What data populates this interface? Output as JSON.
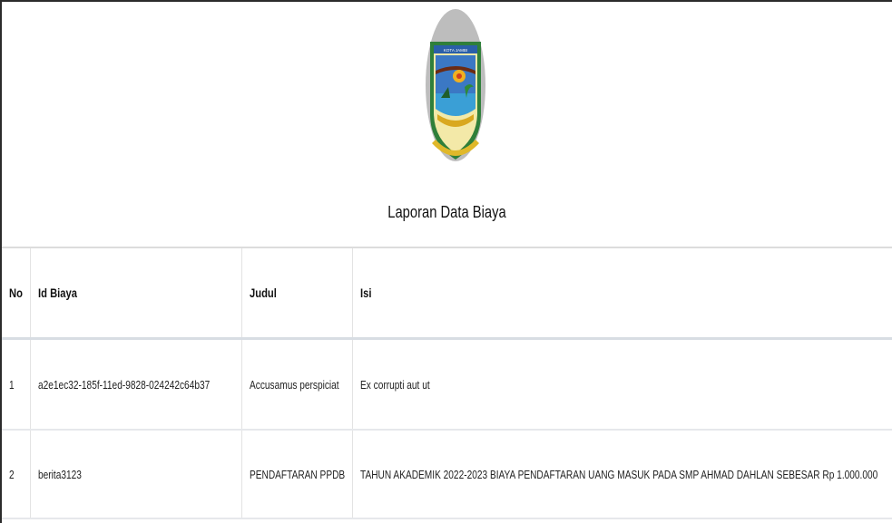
{
  "report": {
    "title": "Laporan Data Biaya",
    "logo": {
      "text": "KOTA JAMBI",
      "icon": "city-crest-icon"
    }
  },
  "table": {
    "headers": {
      "no": "No",
      "id": "Id Biaya",
      "judul": "Judul",
      "isi": "Isi"
    },
    "rows": [
      {
        "no": "1",
        "id": "a2e1ec32-185f-11ed-9828-024242c64b37",
        "judul": "Accusamus perspiciat",
        "isi": "Ex corrupti aut ut"
      },
      {
        "no": "2",
        "id": "berita3123",
        "judul": "PENDAFTARAN PPDB",
        "isi": "TAHUN AKADEMIK 2022-2023 BIAYA PENDAFTARAN UANG MASUK PADA SMP AHMAD DAHLAN SEBESAR Rp 1.000.000"
      }
    ]
  },
  "colors": {
    "border": "#2b2b2b",
    "divider": "#d8dde3",
    "crest_green": "#3a8f3a",
    "crest_gold": "#d9a820"
  }
}
